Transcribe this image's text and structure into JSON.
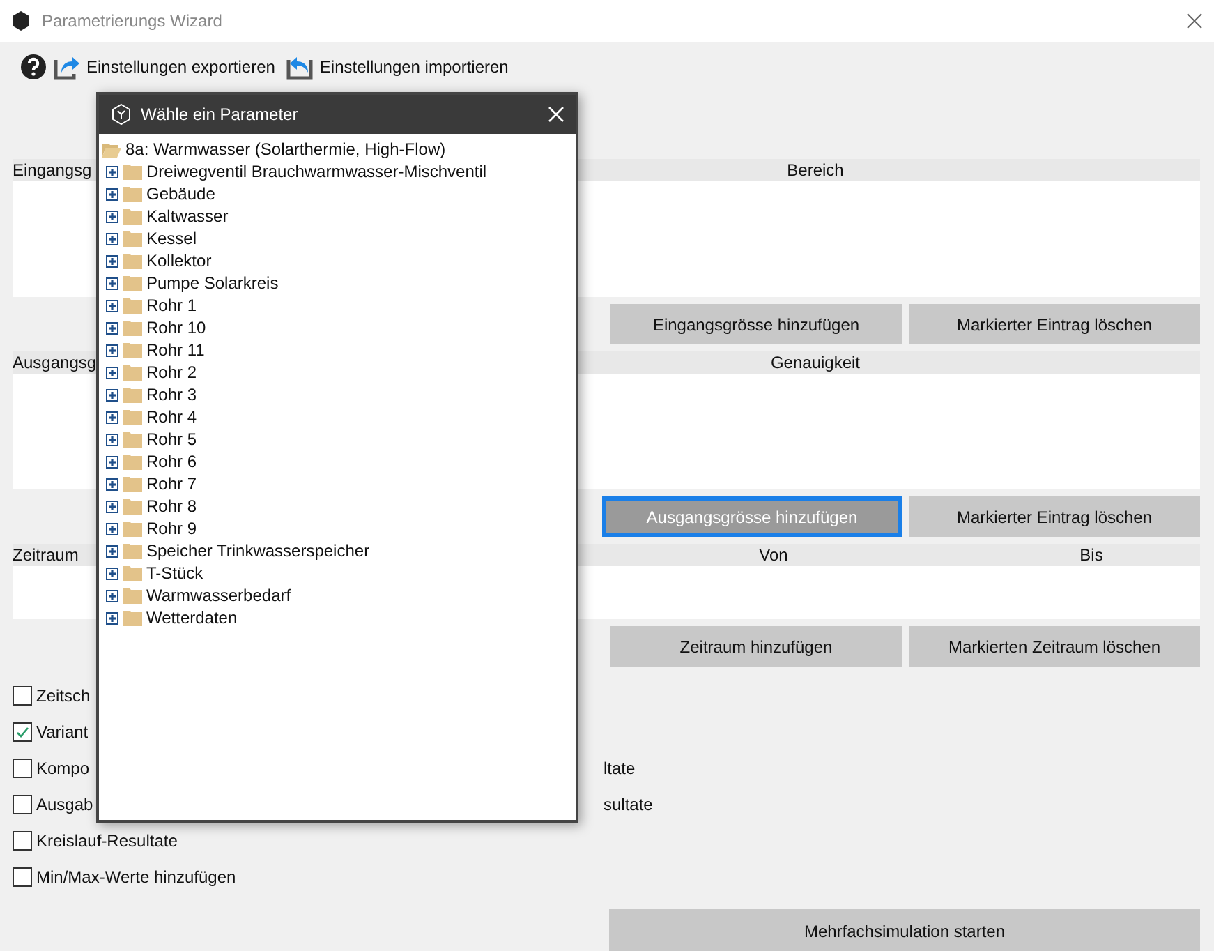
{
  "window": {
    "title": "Parametrierungs Wizard"
  },
  "toolbar": [
    {
      "kind": "help"
    },
    {
      "kind": "export",
      "label": "Einstellungen exportieren"
    },
    {
      "kind": "import",
      "label": "Einstellungen importieren"
    }
  ],
  "sections": [
    {
      "label": "Eingangsg",
      "columns": [
        "Bereich"
      ],
      "buttons": [
        {
          "label": "Eingangsgrösse hinzufügen",
          "focused": false
        },
        {
          "label": "Markierter Eintrag löschen",
          "focused": false
        }
      ]
    },
    {
      "label": "Ausgangsg",
      "columns": [
        "Genauigkeit"
      ],
      "buttons": [
        {
          "label": "Ausgangsgrösse hinzufügen",
          "focused": true
        },
        {
          "label": "Markierter Eintrag löschen",
          "focused": false
        }
      ]
    },
    {
      "label": "Zeitraum",
      "columns": [
        "Von",
        "Bis"
      ],
      "buttons": [
        {
          "label": "Zeitraum hinzufügen",
          "focused": false
        },
        {
          "label": "Markierten Zeitraum löschen",
          "focused": false
        }
      ]
    }
  ],
  "options": [
    {
      "label": "Zeitsch",
      "checked": false
    },
    {
      "label": "Variant",
      "checked": true
    },
    {
      "label": "Kompo",
      "checked": false,
      "right": "ltate"
    },
    {
      "label": "Ausgab",
      "checked": false,
      "right": "sultate"
    },
    {
      "label": "Kreislauf-Resultate",
      "checked": false
    },
    {
      "label": "Min/Max-Werte hinzufügen",
      "checked": false
    }
  ],
  "start_button": "Mehrfachsimulation starten",
  "dialog": {
    "title": "Wähle ein Parameter",
    "tree": {
      "label": "8a: Warmwasser (Solarthermie, High-Flow)",
      "expanded": true,
      "children": [
        {
          "label": "Dreiwegventil Brauchwarmwasser-Mischventil",
          "expanded": false
        },
        {
          "label": "Gebäude",
          "expanded": false
        },
        {
          "label": "Kaltwasser",
          "expanded": false
        },
        {
          "label": "Kessel",
          "expanded": false
        },
        {
          "label": "Kollektor",
          "expanded": false
        },
        {
          "label": "Pumpe Solarkreis",
          "expanded": false
        },
        {
          "label": "Rohr 1",
          "expanded": false
        },
        {
          "label": "Rohr 10",
          "expanded": false
        },
        {
          "label": "Rohr 11",
          "expanded": false
        },
        {
          "label": "Rohr 2",
          "expanded": false
        },
        {
          "label": "Rohr 3",
          "expanded": false
        },
        {
          "label": "Rohr 4",
          "expanded": false
        },
        {
          "label": "Rohr 5",
          "expanded": false
        },
        {
          "label": "Rohr 6",
          "expanded": false
        },
        {
          "label": "Rohr 7",
          "expanded": false
        },
        {
          "label": "Rohr 8",
          "expanded": false
        },
        {
          "label": "Rohr 9",
          "expanded": false
        },
        {
          "label": "Speicher Trinkwasserspeicher",
          "expanded": false
        },
        {
          "label": "T-Stück",
          "expanded": false
        },
        {
          "label": "Warmwasserbedarf",
          "expanded": false
        },
        {
          "label": "Wetterdaten",
          "expanded": false
        }
      ]
    }
  }
}
